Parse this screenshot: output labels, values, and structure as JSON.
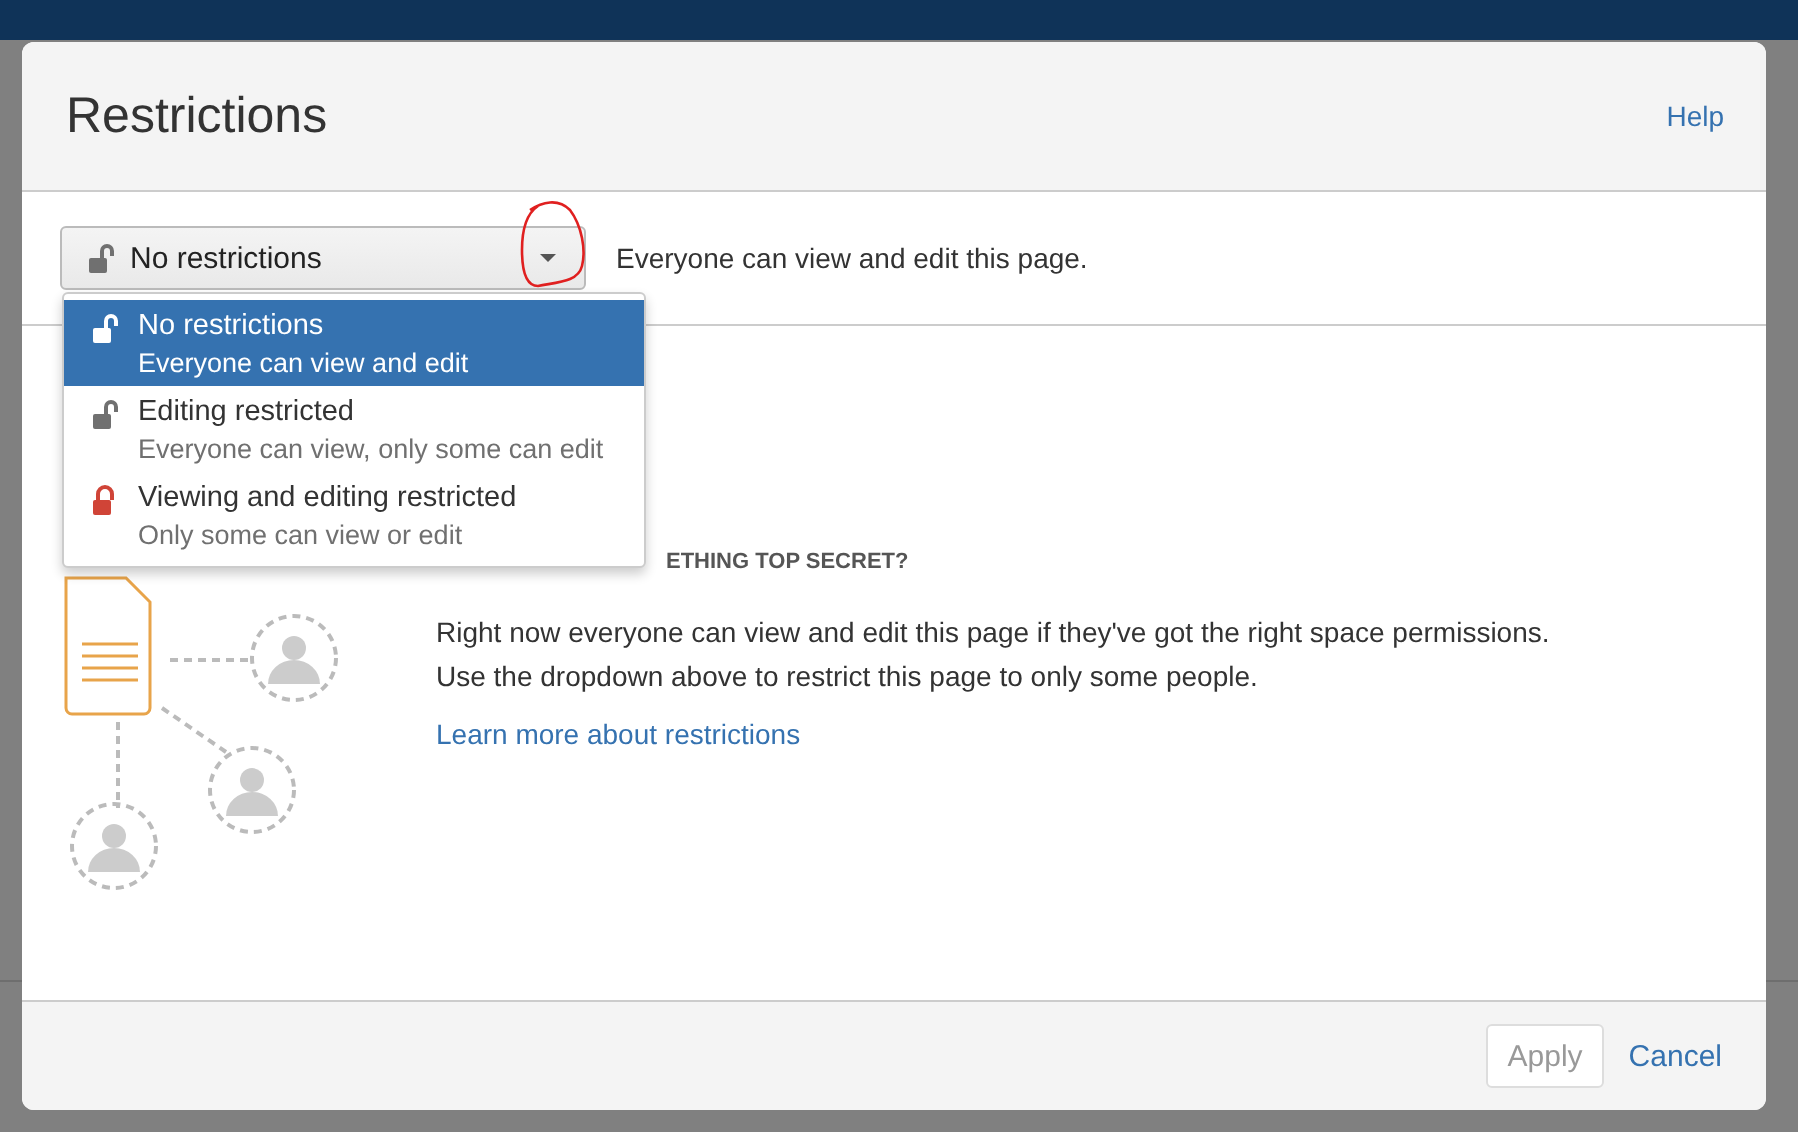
{
  "dialog": {
    "title": "Restrictions",
    "help_link": "Help"
  },
  "restriction_select": {
    "value": "No restrictions",
    "kind": "unlocked",
    "expanded": true
  },
  "description": "Everyone can view and edit this page.",
  "menu_items": [
    {
      "label": "No restrictions",
      "sublabel": "Everyone can view and edit",
      "kind": "unlocked",
      "selected": true
    },
    {
      "label": "Editing restricted",
      "sublabel": "Everyone can view, only some can edit",
      "kind": "unlocked",
      "selected": false
    },
    {
      "label": "Viewing and editing restricted",
      "sublabel": "Only some can view or edit",
      "kind": "locked",
      "selected": false
    }
  ],
  "info": {
    "heading": "ETHING TOP SECRET?",
    "lines": [
      "Right now everyone can view and edit this page if they've got the right space permissions.",
      "Use the dropdown above to restrict this page to only some people."
    ],
    "link": "Learn more about restrictions"
  },
  "footer": {
    "apply": {
      "label": "Apply",
      "disabled": true
    },
    "cancel": "Cancel"
  }
}
